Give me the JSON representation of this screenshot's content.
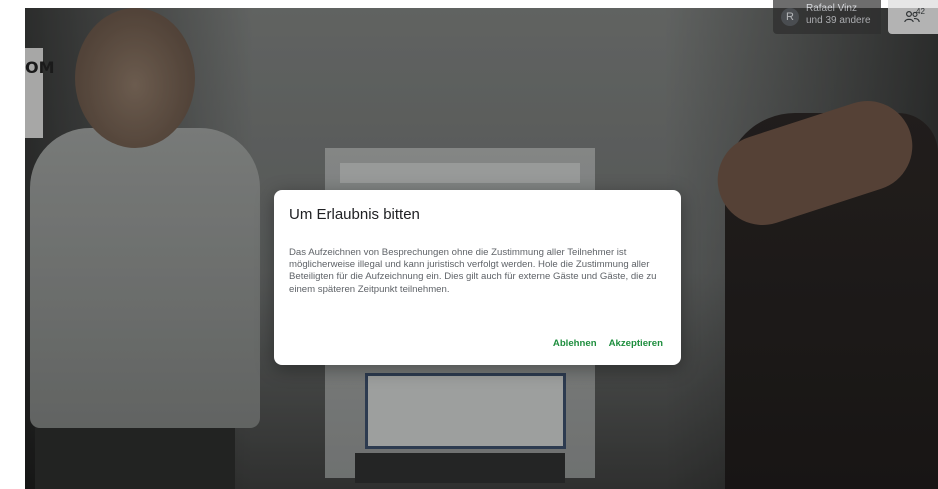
{
  "video": {
    "wall_text": "OM"
  },
  "participants": {
    "avatar_letter": "R",
    "line1": "Rafael Vinz",
    "line2": "und 39 andere"
  },
  "people_button": {
    "count": "42",
    "icon": "people-icon"
  },
  "dialog": {
    "title": "Um Erlaubnis bitten",
    "body": "Das Aufzeichnen von Besprechungen ohne die Zustimmung aller Teilnehmer ist möglicherweise illegal und kann juristisch verfolgt werden. Hole die Zustimmung aller Beteiligten für die Aufzeichnung ein. Dies gilt auch für externe Gäste und Gäste, die zu einem späteren Zeitpunkt teilnehmen.",
    "decline_label": "Ablehnen",
    "accept_label": "Akzeptieren",
    "accent_color": "#1e8e3e"
  }
}
